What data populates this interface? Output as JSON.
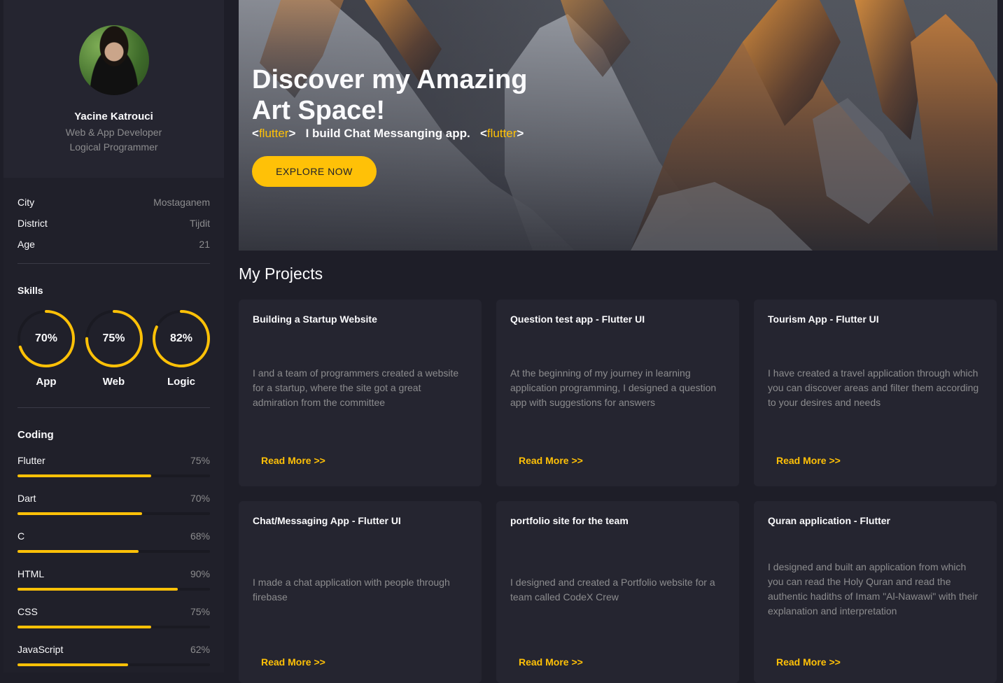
{
  "profile": {
    "name": "Yacine Katrouci",
    "role": "Web & App Developer",
    "role2": "Logical Programmer"
  },
  "info": [
    {
      "label": "City",
      "value": "Mostaganem"
    },
    {
      "label": "District",
      "value": "Tijdit"
    },
    {
      "label": "Age",
      "value": "21"
    }
  ],
  "skills": {
    "title": "Skills",
    "items": [
      {
        "label": "App",
        "percent": "70%",
        "value": 70
      },
      {
        "label": "Web",
        "percent": "75%",
        "value": 75
      },
      {
        "label": "Logic",
        "percent": "82%",
        "value": 82
      }
    ]
  },
  "coding": {
    "title": "Coding",
    "items": [
      {
        "label": "Flutter",
        "percent": "75%",
        "value": 75
      },
      {
        "label": "Dart",
        "percent": "70%",
        "value": 70
      },
      {
        "label": "C",
        "percent": "68%",
        "value": 68
      },
      {
        "label": "HTML",
        "percent": "90%",
        "value": 90
      },
      {
        "label": "CSS",
        "percent": "75%",
        "value": 75
      },
      {
        "label": "JavaScript",
        "percent": "62%",
        "value": 62
      }
    ]
  },
  "hero": {
    "title": "Discover my Amazing Art Space!",
    "tag_open": "<",
    "tag_word": "flutter",
    "tag_close": ">",
    "tagline": "I build Chat Messanging app.",
    "button": "EXPLORE NOW"
  },
  "projects": {
    "title": "My Projects",
    "read_more": "Read More >>",
    "items": [
      {
        "title": "Building a Startup Website",
        "desc": "I and a team of programmers created a website for a startup, where the site got a great admiration from the committee"
      },
      {
        "title": "Question test app - Flutter UI",
        "desc": "At the beginning of my journey in learning application programming, I designed a question app with suggestions for answers"
      },
      {
        "title": "Tourism App - Flutter UI",
        "desc": "I have created a travel application through which you can discover areas and filter them according to your desires and needs"
      },
      {
        "title": "Chat/Messaging App - Flutter UI",
        "desc": "I made a chat application with people through firebase"
      },
      {
        "title": "portfolio site for the team",
        "desc": "I designed and created a Portfolio website for a team called CodeX Crew"
      },
      {
        "title": "Quran application - Flutter",
        "desc": "I designed and built an application from which you can read the Holy Quran and read the authentic hadiths of Imam \"Al-Nawawi\" with their explanation and interpretation"
      }
    ]
  },
  "colors": {
    "accent": "#ffc107",
    "bg": "#1e1e28",
    "card": "#252530",
    "muted": "#8c8c8e"
  }
}
